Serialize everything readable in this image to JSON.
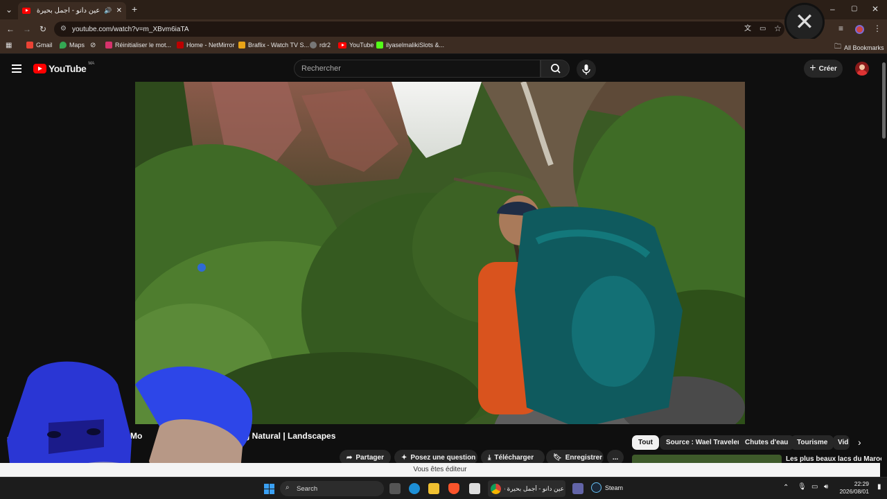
{
  "browser": {
    "tab_title": "عين دانو - أجمل بحيرة في ش",
    "new_tab": "+",
    "url": "youtube.com/watch?v=m_XBvm6iaTA",
    "bookmarks": [
      "Gmail",
      "Maps",
      "Réinitialiser le mot...",
      "Home - NetMirror",
      "Braflix - Watch TV S...",
      "rdr2",
      "YouTube",
      "ilyaselmalikiSlots &..."
    ],
    "all_bookmarks": "All Bookmarks"
  },
  "youtube": {
    "logo": "YouTube",
    "region": "MA",
    "search_placeholder": "Rechercher",
    "create_label": "Créer",
    "video_title_left": "Mo",
    "video_title_right": "g Natural | Landscapes",
    "actions": [
      "Partager",
      "Posez une question",
      "Télécharger",
      "Enregistrer"
    ],
    "more": "...",
    "chips": [
      "Tout",
      "Source : Wael Traveler",
      "Chutes d'eau",
      "Tourisme",
      "Vid"
    ],
    "recommended_title": "Les plus beaux lacs du Maroc",
    "editor_banner": "Vous êtes éditeur"
  },
  "taskbar": {
    "search": "Search",
    "window_title": "عين دانو - أجمل بحيرة في",
    "steam": "Steam",
    "time": "22:29",
    "date": "2026/08/01"
  },
  "colors": {
    "youtube_red": "#ff0000",
    "chrome_bg": "#3c2c22",
    "yt_bg": "#0f0f0f"
  }
}
